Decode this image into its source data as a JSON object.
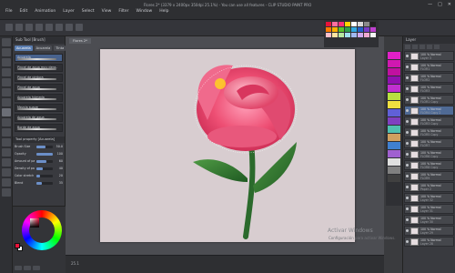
{
  "window": {
    "title": "Flores 2* (3379 x 2400px 350dpi 25.1%) - You can use all features - CLIP STUDIO PAINT PRO",
    "controls": [
      "—",
      "□",
      "✕"
    ]
  },
  "menu": [
    "File",
    "Edit",
    "Animation",
    "Layer",
    "Select",
    "View",
    "Filter",
    "Window",
    "Help"
  ],
  "canvas": {
    "tab_label": "Flores 2*",
    "background": "#d8cdd0"
  },
  "tool_panel": {
    "header": "Sub Tool [Brush]",
    "tabs": [
      "Acuarela",
      "Acuarela",
      "Tinta"
    ],
    "brushes": [
      "Acuarela",
      "Pincel de agua muy dens.",
      "Pincel de pintura",
      "Pincel de agua",
      "Acuarela húmeda",
      "Mezcla suave",
      "Acuarela de agua",
      "Borde de agua"
    ],
    "properties_header": "Tool property [Acuarela]",
    "properties": [
      {
        "label": "Brush Size",
        "value": "50.0",
        "fraction": 0.55
      },
      {
        "label": "Opacity",
        "value": "100",
        "fraction": 1.0
      },
      {
        "label": "Amount of paint",
        "value": "60",
        "fraction": 0.6
      },
      {
        "label": "Density of paint",
        "value": "40",
        "fraction": 0.4
      },
      {
        "label": "Color stretch",
        "value": "20",
        "fraction": 0.2
      },
      {
        "label": "Blend",
        "value": "35",
        "fraction": 0.35
      }
    ]
  },
  "colors": {
    "main": "#e8123a",
    "sub": "#ffffff",
    "palette": [
      "#e8123a",
      "#ff6fa0",
      "#ff2f7a",
      "#ffd400",
      "#ffffff",
      "#d9d9d9",
      "#8a8a8a",
      "#222222",
      "#ff7a00",
      "#ffb000",
      "#5ac22b",
      "#2da04a",
      "#30a8e0",
      "#2460c8",
      "#7a3cc8",
      "#c040d0",
      "#ffc0cb",
      "#ffe4a0",
      "#b8e8a0",
      "#a0e0f0",
      "#a0b8f0",
      "#d0a8f0",
      "#f0a8d0",
      "#f5f5f5"
    ],
    "strip": [
      "#e020c8",
      "#d018b0",
      "#c010a0",
      "#9010b0",
      "#c030d0",
      "#b8e040",
      "#f0e040",
      "#6060d8",
      "#8040c0",
      "#50c0b0",
      "#d0a060",
      "#4080d0",
      "#a060d0",
      "#e0e0e0",
      "#808080",
      "#404040"
    ]
  },
  "layers_panel": {
    "header": "Layer",
    "layers": [
      {
        "name": "100 % Normal",
        "mode": "Layer 3",
        "selected": false
      },
      {
        "name": "100 % Normal",
        "mode": "FLOR1",
        "selected": false
      },
      {
        "name": "100 % Normal",
        "mode": "FLOR2",
        "selected": false
      },
      {
        "name": "100 % Normal",
        "mode": "FLOR3",
        "selected": false
      },
      {
        "name": "100 % Normal",
        "mode": "FLOR1 Copy",
        "selected": false
      },
      {
        "name": "100 % Normal",
        "mode": "FLOR4 Copy 2",
        "selected": true
      },
      {
        "name": "100 % Normal",
        "mode": "FLOR3 Copy",
        "selected": false
      },
      {
        "name": "100 % Normal",
        "mode": "FLOR5 Copy",
        "selected": false
      },
      {
        "name": "100 % Normal",
        "mode": "FLOR7",
        "selected": false
      },
      {
        "name": "100 % Normal",
        "mode": "FLOR6 Copy",
        "selected": false
      },
      {
        "name": "100 % Normal",
        "mode": "FLOR8 Copy",
        "selected": false
      },
      {
        "name": "100 % Normal",
        "mode": "FLOR9",
        "selected": false
      },
      {
        "name": "100 % Normal",
        "mode": "Paper 2",
        "selected": false
      },
      {
        "name": "100 % Normal",
        "mode": "Layer 32",
        "selected": false
      },
      {
        "name": "100 % Normal",
        "mode": "Layer 31",
        "selected": false
      },
      {
        "name": "100 % Normal",
        "mode": "Layer 30",
        "selected": false
      },
      {
        "name": "100 % Normal",
        "mode": "Layer 29",
        "selected": false
      },
      {
        "name": "100 % Normal",
        "mode": "Layer 28",
        "selected": false
      }
    ]
  },
  "status": {
    "zoom": "25.1",
    "coords": "Activar Windows"
  },
  "watermark": {
    "title": "Activar Windows",
    "subtitle": "Configuración para activar Windows."
  }
}
